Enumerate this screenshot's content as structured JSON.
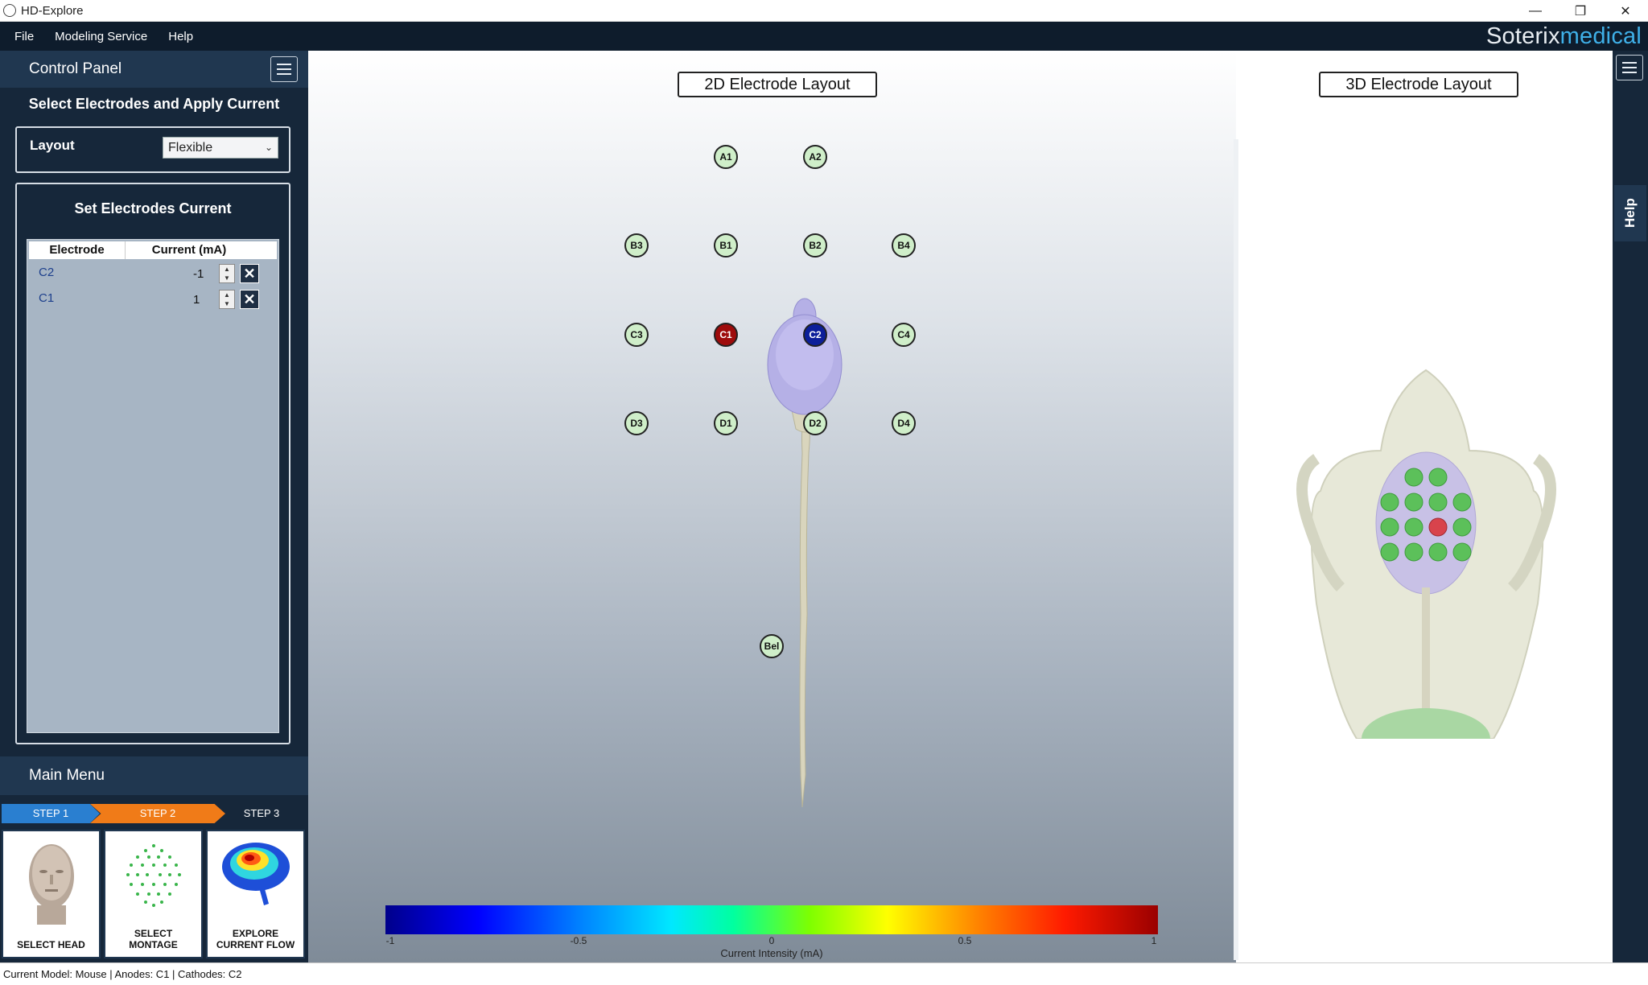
{
  "window": {
    "title": "HD-Explore",
    "minimize": "—",
    "restore": "❐",
    "close": "✕"
  },
  "menu": {
    "file": "File",
    "modeling": "Modeling Service",
    "help": "Help"
  },
  "logo": {
    "part1": "Soterix",
    "part2": "medical"
  },
  "control_panel": {
    "title": "Control Panel",
    "section_title": "Select Electrodes and Apply Current",
    "layout_label": "Layout",
    "layout_value": "Flexible",
    "electrodes_title": "Set Electrodes Current",
    "columns": [
      "Electrode",
      "Current (mA)"
    ],
    "rows": [
      {
        "electrode": "C2",
        "current": "-1"
      },
      {
        "electrode": "C1",
        "current": "1"
      }
    ]
  },
  "main_menu": {
    "title": "Main Menu",
    "steps": [
      "STEP 1",
      "STEP 2",
      "STEP 3"
    ],
    "tiles": [
      {
        "line1": "SELECT HEAD",
        "line2": ""
      },
      {
        "line1": "SELECT",
        "line2": "MONTAGE"
      },
      {
        "line1": "EXPLORE",
        "line2": "CURRENT FLOW"
      }
    ]
  },
  "views": {
    "title_2d": "2D Electrode Layout",
    "title_3d": "3D Electrode Layout"
  },
  "electrodes": [
    {
      "label": "A1",
      "state": "none"
    },
    {
      "label": "A2",
      "state": "none"
    },
    {
      "label": "B3",
      "state": "none"
    },
    {
      "label": "B1",
      "state": "none"
    },
    {
      "label": "B2",
      "state": "none"
    },
    {
      "label": "B4",
      "state": "none"
    },
    {
      "label": "C3",
      "state": "none"
    },
    {
      "label": "C1",
      "state": "anode"
    },
    {
      "label": "C2",
      "state": "cathode"
    },
    {
      "label": "C4",
      "state": "none"
    },
    {
      "label": "D3",
      "state": "none"
    },
    {
      "label": "D1",
      "state": "none"
    },
    {
      "label": "D2",
      "state": "none"
    },
    {
      "label": "D4",
      "state": "none"
    },
    {
      "label": "Bel",
      "state": "none"
    }
  ],
  "colorbar": {
    "ticks": [
      "-1",
      "-0.5",
      "0",
      "0.5",
      "1"
    ],
    "label": "Current Intensity (mA)"
  },
  "help_tab": "Help",
  "status": "Current Model: Mouse  |  Anodes: C1  |  Cathodes: C2",
  "colors": {
    "accent": "#3fb0e8",
    "anode": "#9e0b0b",
    "cathode": "#0c1e9a",
    "step_active": "#f07b18",
    "step_done": "#2a7fd0"
  }
}
